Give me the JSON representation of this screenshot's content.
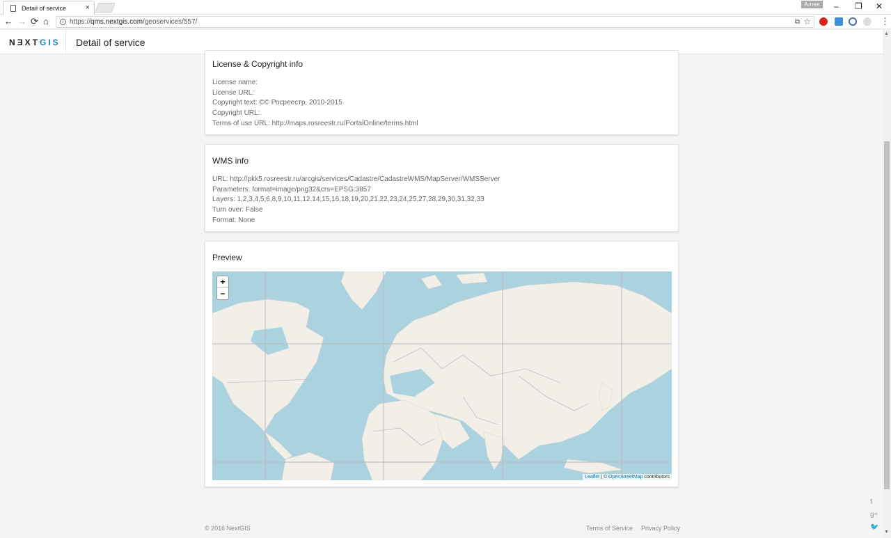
{
  "browser": {
    "tab_title": "Detail of service",
    "tab_close": "×",
    "profile_label": "Алтея",
    "url_prefix": "https://",
    "url_host": "qms.nextgis.com",
    "url_path": "/geoservices/557/",
    "nav": {
      "back": "←",
      "forward": "→",
      "reload": "⟳",
      "home": "⌂"
    },
    "window": {
      "minimize": "–",
      "restore": "❐",
      "close": "✕"
    },
    "star": "☆",
    "translate": "⧉",
    "menu": "⋮"
  },
  "app": {
    "logo_main": "NƎXT",
    "logo_accent": "GIS",
    "page_title": "Detail of service"
  },
  "license": {
    "title": "License & Copyright info",
    "license_name": "License name:",
    "license_url": "License URL:",
    "copyright_text": "Copyright text: ©© Росреестр, 2010-2015",
    "copyright_url": "Copyright URL:",
    "terms_url": "Terms of use URL: http://maps.rosreestr.ru/PortalOnline/terms.html"
  },
  "wms": {
    "title": "WMS info",
    "url": "URL: http://pkk5.rosreestr.ru/arcgis/services/Cadastre/CadastreWMS/MapServer/WMSServer",
    "parameters": "Parameters: format=image/png32&crs=EPSG:3857",
    "layers": "Layers: 1,2,3,4,5,6,8,9,10,11,12,14,15,16,18,19,20,21,22,23,24,25,27,28,29,30,31,32,33",
    "turn_over": "Turn over: False",
    "format": "Format: None"
  },
  "preview": {
    "title": "Preview",
    "zoom_in": "+",
    "zoom_out": "−",
    "attribution_leaflet": "Leaflet",
    "attribution_sep": " | © ",
    "attribution_osm": "OpenStreetMap",
    "attribution_suffix": " contributors",
    "colors": {
      "water": "#aad3df",
      "land": "#f2efe9",
      "border": "#c6a0c6",
      "grid": "#b9b9b9"
    }
  },
  "footer": {
    "copyright": "© 2016 NextGIS",
    "terms": "Terms of Service",
    "privacy": "Privacy Policy",
    "social": {
      "facebook": "f",
      "gplus": "g+",
      "twitter": "🐦"
    }
  }
}
